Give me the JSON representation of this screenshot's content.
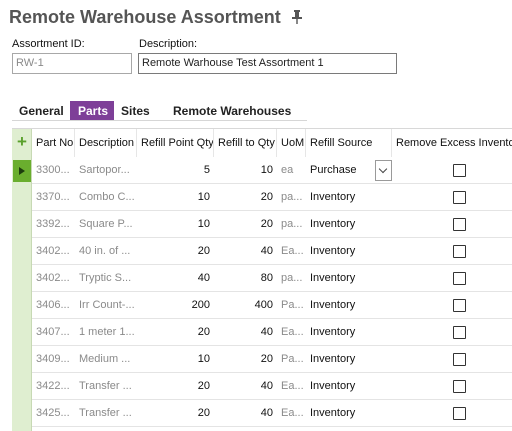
{
  "header": {
    "title": "Remote Warehouse Assortment"
  },
  "form": {
    "assortment_id_label": "Assortment ID:",
    "assortment_id_value": "RW-1",
    "description_label": "Description:",
    "description_value": "Remote Warhouse Test Assortment 1"
  },
  "tabs": [
    {
      "label": "General",
      "active": false
    },
    {
      "label": "Parts",
      "active": true
    },
    {
      "label": "Sites",
      "active": false
    },
    {
      "label": "Remote Warehouses",
      "active": false
    }
  ],
  "grid": {
    "columns": [
      {
        "key": "part_no",
        "label": "Part No"
      },
      {
        "key": "description",
        "label": "Description"
      },
      {
        "key": "refill_point_qty",
        "label": "Refill Point Qty"
      },
      {
        "key": "refill_to_qty",
        "label": "Refill to Qty"
      },
      {
        "key": "uom",
        "label": "UoM"
      },
      {
        "key": "refill_source",
        "label": "Refill Source"
      },
      {
        "key": "remove_excess",
        "label": "Remove Excess Inventory"
      }
    ],
    "rows": [
      {
        "part_no": "3300...",
        "description": "Sartopor...",
        "refill_point_qty": "5",
        "refill_to_qty": "10",
        "uom": "ea",
        "refill_source": "Purchase",
        "remove_excess": false,
        "selected": true
      },
      {
        "part_no": "3370...",
        "description": "Combo C...",
        "refill_point_qty": "10",
        "refill_to_qty": "20",
        "uom": "pa...",
        "refill_source": "Inventory",
        "remove_excess": false,
        "selected": false
      },
      {
        "part_no": "3392...",
        "description": "Square P...",
        "refill_point_qty": "10",
        "refill_to_qty": "20",
        "uom": "pa...",
        "refill_source": "Inventory",
        "remove_excess": false,
        "selected": false
      },
      {
        "part_no": "3402...",
        "description": "40 in. of ...",
        "refill_point_qty": "20",
        "refill_to_qty": "40",
        "uom": "Ea...",
        "refill_source": "Inventory",
        "remove_excess": false,
        "selected": false
      },
      {
        "part_no": "3402...",
        "description": "Tryptic S...",
        "refill_point_qty": "40",
        "refill_to_qty": "80",
        "uom": "pa...",
        "refill_source": "Inventory",
        "remove_excess": false,
        "selected": false
      },
      {
        "part_no": "3406...",
        "description": "Irr Count-...",
        "refill_point_qty": "200",
        "refill_to_qty": "400",
        "uom": "Pa...",
        "refill_source": "Inventory",
        "remove_excess": false,
        "selected": false
      },
      {
        "part_no": "3407...",
        "description": "1 meter 1...",
        "refill_point_qty": "20",
        "refill_to_qty": "40",
        "uom": "Ea...",
        "refill_source": "Inventory",
        "remove_excess": false,
        "selected": false
      },
      {
        "part_no": "3409...",
        "description": "Medium ...",
        "refill_point_qty": "10",
        "refill_to_qty": "20",
        "uom": "Pa...",
        "refill_source": "Inventory",
        "remove_excess": false,
        "selected": false
      },
      {
        "part_no": "3422...",
        "description": "Transfer ...",
        "refill_point_qty": "20",
        "refill_to_qty": "40",
        "uom": "Ea...",
        "refill_source": "Inventory",
        "remove_excess": false,
        "selected": false
      },
      {
        "part_no": "3425...",
        "description": "Transfer ...",
        "refill_point_qty": "20",
        "refill_to_qty": "40",
        "uom": "Ea...",
        "refill_source": "Inventory",
        "remove_excess": false,
        "selected": false
      }
    ]
  },
  "icons": {
    "pin": "pin-icon",
    "add": "plus-icon",
    "dropdown": "chevron-down-icon",
    "row_selected": "play-arrow-icon"
  },
  "colors": {
    "accent": "#7e3f98",
    "gutter": "#dfeed0",
    "selected_marker": "#6aae2e",
    "add_icon": "#5aa02c"
  }
}
